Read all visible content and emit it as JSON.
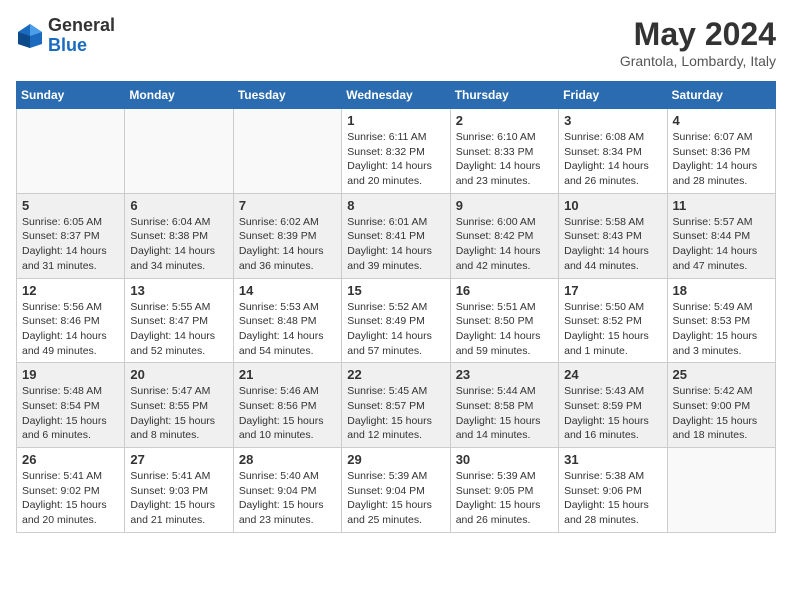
{
  "header": {
    "logo_general": "General",
    "logo_blue": "Blue",
    "month_title": "May 2024",
    "location": "Grantola, Lombardy, Italy"
  },
  "weekdays": [
    "Sunday",
    "Monday",
    "Tuesday",
    "Wednesday",
    "Thursday",
    "Friday",
    "Saturday"
  ],
  "weeks": [
    {
      "shaded": false,
      "days": [
        {
          "num": "",
          "info": ""
        },
        {
          "num": "",
          "info": ""
        },
        {
          "num": "",
          "info": ""
        },
        {
          "num": "1",
          "info": "Sunrise: 6:11 AM\nSunset: 8:32 PM\nDaylight: 14 hours\nand 20 minutes."
        },
        {
          "num": "2",
          "info": "Sunrise: 6:10 AM\nSunset: 8:33 PM\nDaylight: 14 hours\nand 23 minutes."
        },
        {
          "num": "3",
          "info": "Sunrise: 6:08 AM\nSunset: 8:34 PM\nDaylight: 14 hours\nand 26 minutes."
        },
        {
          "num": "4",
          "info": "Sunrise: 6:07 AM\nSunset: 8:36 PM\nDaylight: 14 hours\nand 28 minutes."
        }
      ]
    },
    {
      "shaded": true,
      "days": [
        {
          "num": "5",
          "info": "Sunrise: 6:05 AM\nSunset: 8:37 PM\nDaylight: 14 hours\nand 31 minutes."
        },
        {
          "num": "6",
          "info": "Sunrise: 6:04 AM\nSunset: 8:38 PM\nDaylight: 14 hours\nand 34 minutes."
        },
        {
          "num": "7",
          "info": "Sunrise: 6:02 AM\nSunset: 8:39 PM\nDaylight: 14 hours\nand 36 minutes."
        },
        {
          "num": "8",
          "info": "Sunrise: 6:01 AM\nSunset: 8:41 PM\nDaylight: 14 hours\nand 39 minutes."
        },
        {
          "num": "9",
          "info": "Sunrise: 6:00 AM\nSunset: 8:42 PM\nDaylight: 14 hours\nand 42 minutes."
        },
        {
          "num": "10",
          "info": "Sunrise: 5:58 AM\nSunset: 8:43 PM\nDaylight: 14 hours\nand 44 minutes."
        },
        {
          "num": "11",
          "info": "Sunrise: 5:57 AM\nSunset: 8:44 PM\nDaylight: 14 hours\nand 47 minutes."
        }
      ]
    },
    {
      "shaded": false,
      "days": [
        {
          "num": "12",
          "info": "Sunrise: 5:56 AM\nSunset: 8:46 PM\nDaylight: 14 hours\nand 49 minutes."
        },
        {
          "num": "13",
          "info": "Sunrise: 5:55 AM\nSunset: 8:47 PM\nDaylight: 14 hours\nand 52 minutes."
        },
        {
          "num": "14",
          "info": "Sunrise: 5:53 AM\nSunset: 8:48 PM\nDaylight: 14 hours\nand 54 minutes."
        },
        {
          "num": "15",
          "info": "Sunrise: 5:52 AM\nSunset: 8:49 PM\nDaylight: 14 hours\nand 57 minutes."
        },
        {
          "num": "16",
          "info": "Sunrise: 5:51 AM\nSunset: 8:50 PM\nDaylight: 14 hours\nand 59 minutes."
        },
        {
          "num": "17",
          "info": "Sunrise: 5:50 AM\nSunset: 8:52 PM\nDaylight: 15 hours\nand 1 minute."
        },
        {
          "num": "18",
          "info": "Sunrise: 5:49 AM\nSunset: 8:53 PM\nDaylight: 15 hours\nand 3 minutes."
        }
      ]
    },
    {
      "shaded": true,
      "days": [
        {
          "num": "19",
          "info": "Sunrise: 5:48 AM\nSunset: 8:54 PM\nDaylight: 15 hours\nand 6 minutes."
        },
        {
          "num": "20",
          "info": "Sunrise: 5:47 AM\nSunset: 8:55 PM\nDaylight: 15 hours\nand 8 minutes."
        },
        {
          "num": "21",
          "info": "Sunrise: 5:46 AM\nSunset: 8:56 PM\nDaylight: 15 hours\nand 10 minutes."
        },
        {
          "num": "22",
          "info": "Sunrise: 5:45 AM\nSunset: 8:57 PM\nDaylight: 15 hours\nand 12 minutes."
        },
        {
          "num": "23",
          "info": "Sunrise: 5:44 AM\nSunset: 8:58 PM\nDaylight: 15 hours\nand 14 minutes."
        },
        {
          "num": "24",
          "info": "Sunrise: 5:43 AM\nSunset: 8:59 PM\nDaylight: 15 hours\nand 16 minutes."
        },
        {
          "num": "25",
          "info": "Sunrise: 5:42 AM\nSunset: 9:00 PM\nDaylight: 15 hours\nand 18 minutes."
        }
      ]
    },
    {
      "shaded": false,
      "days": [
        {
          "num": "26",
          "info": "Sunrise: 5:41 AM\nSunset: 9:02 PM\nDaylight: 15 hours\nand 20 minutes."
        },
        {
          "num": "27",
          "info": "Sunrise: 5:41 AM\nSunset: 9:03 PM\nDaylight: 15 hours\nand 21 minutes."
        },
        {
          "num": "28",
          "info": "Sunrise: 5:40 AM\nSunset: 9:04 PM\nDaylight: 15 hours\nand 23 minutes."
        },
        {
          "num": "29",
          "info": "Sunrise: 5:39 AM\nSunset: 9:04 PM\nDaylight: 15 hours\nand 25 minutes."
        },
        {
          "num": "30",
          "info": "Sunrise: 5:39 AM\nSunset: 9:05 PM\nDaylight: 15 hours\nand 26 minutes."
        },
        {
          "num": "31",
          "info": "Sunrise: 5:38 AM\nSunset: 9:06 PM\nDaylight: 15 hours\nand 28 minutes."
        },
        {
          "num": "",
          "info": ""
        }
      ]
    }
  ]
}
